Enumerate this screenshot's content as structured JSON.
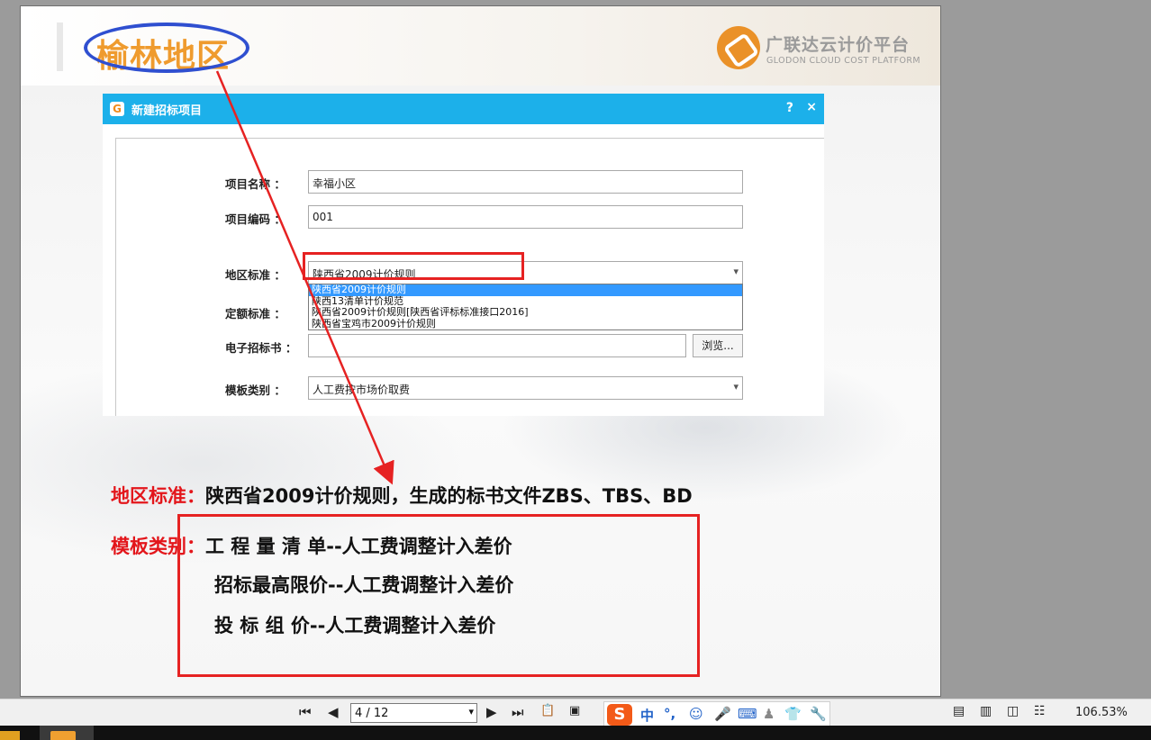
{
  "slide": {
    "title": "榆林地区",
    "logo_cn": "广联达云计价平台",
    "logo_en": "GLODON CLOUD COST PLATFORM"
  },
  "dialog": {
    "title": "新建招标项目",
    "help": "?",
    "close": "×",
    "fields": {
      "project_name_label": "项目名称 ：",
      "project_name_value": "幸福小区",
      "project_code_label": "项目编码 ：",
      "project_code_value": "001",
      "region_label": "地区标准 ：",
      "region_value": "陕西省2009计价规则",
      "quota_label": "定额标准 ：",
      "etender_label": "电子招标书 ：",
      "etender_value": "",
      "browse_label": "浏览...",
      "template_label": "模板类别 ：",
      "template_value": "人工费按市场价取费"
    },
    "region_options": [
      "陕西省2009计价规则",
      "陕西13清单计价规范",
      "陕西省2009计价规则[陕西省评标标准接口2016]",
      "陕西省宝鸡市2009计价规则"
    ],
    "region_selected_index": 0
  },
  "notes": {
    "region_label": "地区标准：",
    "region_text": "陕西省2009计价规则，生成的标书文件ZBS、TBS、BD",
    "template_label": "模板类别：",
    "template_lines": [
      "工 程 量 清 单--人工费调整计入差价",
      "招标最高限价--人工费调整计入差价",
      "投  标  组  价--人工费调整计入差价"
    ]
  },
  "viewer": {
    "page_indicator": "4 / 12",
    "zoom": "106.53%",
    "ime_mode": "中"
  },
  "colors": {
    "dialog_titlebar": "#1cb0ea",
    "highlight_red": "#e62222",
    "title_orange": "#ef9b2e",
    "ellipse_blue": "#2f4fd0",
    "selection_blue": "#3399ff"
  }
}
